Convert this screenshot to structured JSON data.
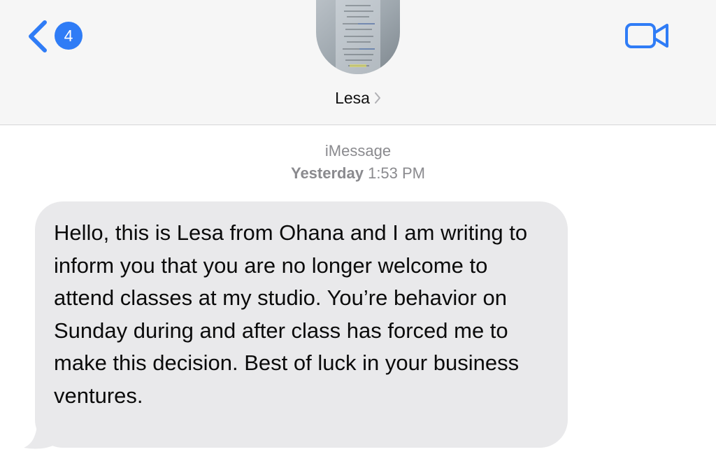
{
  "header": {
    "unread_count": "4",
    "contact_name": "Lesa"
  },
  "conversation": {
    "service": "iMessage",
    "timestamp_day": "Yesterday",
    "timestamp_time": "1:53 PM",
    "messages": [
      {
        "direction": "incoming",
        "text": "Hello, this is Lesa from Ohana and I am writing to inform you that you are no longer welcome to attend classes at my studio. You’re behavior on Sunday during and after class has forced me to make this decision. Best of luck in your business ventures."
      }
    ]
  },
  "colors": {
    "accent": "#2f7cf6",
    "header_bg": "#f6f6f6",
    "incoming_bubble": "#e9e9eb",
    "meta_text": "#8a8a8e"
  },
  "icons": {
    "back": "chevron-left-icon",
    "video": "video-camera-icon",
    "contact_details": "chevron-right-icon"
  }
}
